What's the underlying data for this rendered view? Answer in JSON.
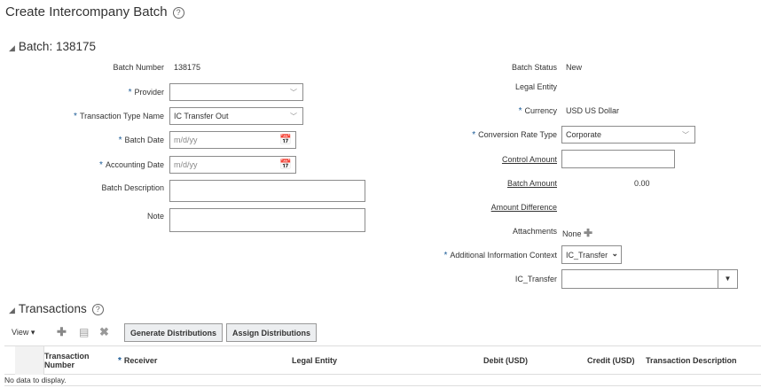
{
  "page": {
    "title": "Create Intercompany Batch"
  },
  "batch": {
    "section_title": "Batch: 138175",
    "left": {
      "batch_number_label": "Batch Number",
      "batch_number": "138175",
      "provider_label": "Provider",
      "provider_value": "",
      "transaction_type_label": "Transaction Type Name",
      "transaction_type_value": "IC Transfer Out",
      "batch_date_label": "Batch Date",
      "batch_date_placeholder": "m/d/yy",
      "accounting_date_label": "Accounting Date",
      "accounting_date_placeholder": "m/d/yy",
      "batch_description_label": "Batch Description",
      "note_label": "Note"
    },
    "right": {
      "batch_status_label": "Batch Status",
      "batch_status": "New",
      "legal_entity_label": "Legal Entity",
      "currency_label": "Currency",
      "currency": "USD US Dollar",
      "conversion_rate_type_label": "Conversion Rate Type",
      "conversion_rate_type": "Corporate",
      "control_amount_label": "Control Amount",
      "batch_amount_label": "Batch Amount",
      "batch_amount": "0.00",
      "amount_difference_label": "Amount Difference",
      "attachments_label": "Attachments",
      "attachments": "None",
      "additional_context_label": "Additional Information Context",
      "additional_context": "IC_Transfer",
      "ic_transfer_label": "IC_Transfer"
    }
  },
  "transactions": {
    "section_title": "Transactions",
    "view_label": "View",
    "generate_button": "Generate Distributions",
    "assign_button": "Assign Distributions",
    "columns": [
      "Transaction Number",
      "Receiver",
      "Legal Entity",
      "Debit (USD)",
      "Credit (USD)",
      "Transaction Description"
    ],
    "empty": "No data to display."
  },
  "colors": {
    "required": "#1a5a96",
    "button_bg": "#eceef0"
  }
}
